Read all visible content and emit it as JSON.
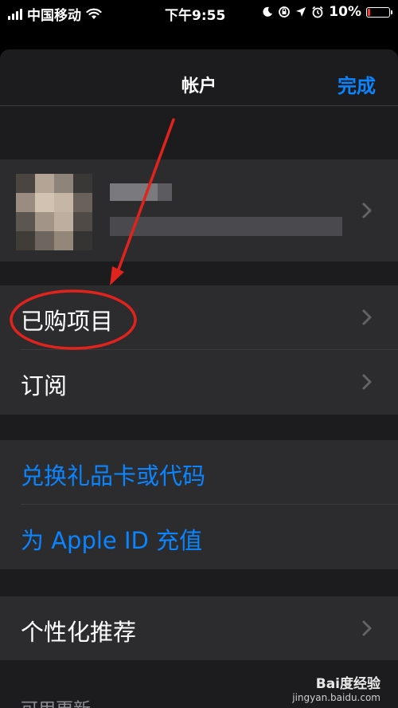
{
  "status_bar": {
    "carrier": "中国移动",
    "time": "下午9:55",
    "battery": "10%"
  },
  "nav": {
    "title": "帐户",
    "done": "完成"
  },
  "rows": {
    "purchased": "已购项目",
    "subscriptions": "订阅",
    "redeem": "兑换礼品卡或代码",
    "add_funds": "为 Apple ID 充值",
    "personalized": "个性化推荐",
    "updates": "可用更新"
  },
  "watermark": {
    "brand": "Bai度经验",
    "url": "jingyan.baidu.com"
  },
  "colors": {
    "accent": "#0a84ff",
    "annotation": "#e0231c"
  }
}
